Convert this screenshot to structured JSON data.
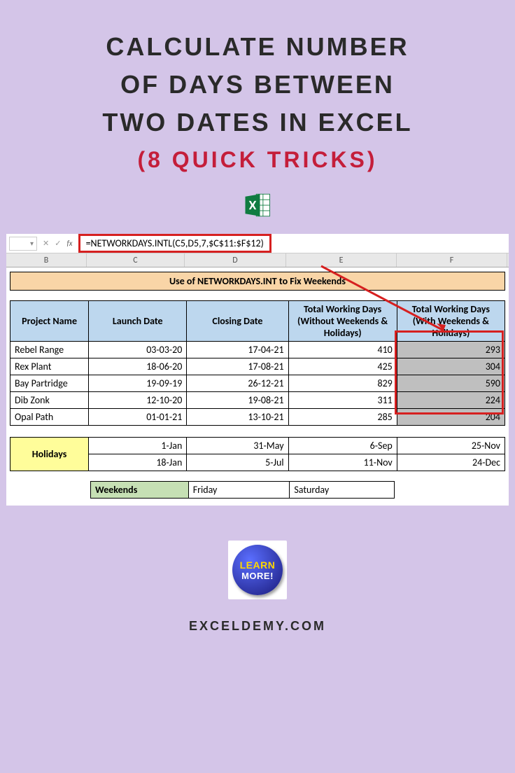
{
  "title": {
    "line1": "CALCULATE NUMBER",
    "line2": "OF DAYS BETWEEN",
    "line3": "TWO DATES IN EXCEL",
    "subtitle": "(8 QUICK TRICKS)"
  },
  "formula_bar": {
    "fx_label": "fx",
    "formula": "=NETWORKDAYS.INTL(C5,D5,7,$C$11:$F$12)"
  },
  "columns": [
    "B",
    "C",
    "D",
    "E",
    "F"
  ],
  "sheet_title": "Use of NETWORKDAYS.INT  to Fix Weekends",
  "headers": {
    "project": "Project Name",
    "launch": "Launch Date",
    "closing": "Closing Date",
    "without": "Total Working Days (Without Weekends & Holidays)",
    "with": "Total Working Days (With Weekends & Holidays)"
  },
  "rows": [
    {
      "project": "Rebel Range",
      "launch": "03-03-20",
      "closing": "17-04-21",
      "without": "410",
      "with": "293"
    },
    {
      "project": "Rex Plant",
      "launch": "18-06-20",
      "closing": "17-08-21",
      "without": "425",
      "with": "304"
    },
    {
      "project": "Bay Partridge",
      "launch": "19-09-19",
      "closing": "26-12-21",
      "without": "829",
      "with": "590"
    },
    {
      "project": "Dib Zonk",
      "launch": "12-10-20",
      "closing": "19-08-21",
      "without": "311",
      "with": "224"
    },
    {
      "project": "Opal Path",
      "launch": "01-01-21",
      "closing": "13-10-21",
      "without": "285",
      "with": "204"
    }
  ],
  "holidays": {
    "label": "Holidays",
    "row1": [
      "1-Jan",
      "31-May",
      "6-Sep",
      "25-Nov"
    ],
    "row2": [
      "18-Jan",
      "5-Jul",
      "11-Nov",
      "24-Dec"
    ]
  },
  "weekends": {
    "label": "Weekends",
    "day1": "Friday",
    "day2": "Saturday"
  },
  "learn_more": {
    "line1": "LEARN",
    "line2": "MORE!"
  },
  "site": "EXCELDEMY.COM"
}
